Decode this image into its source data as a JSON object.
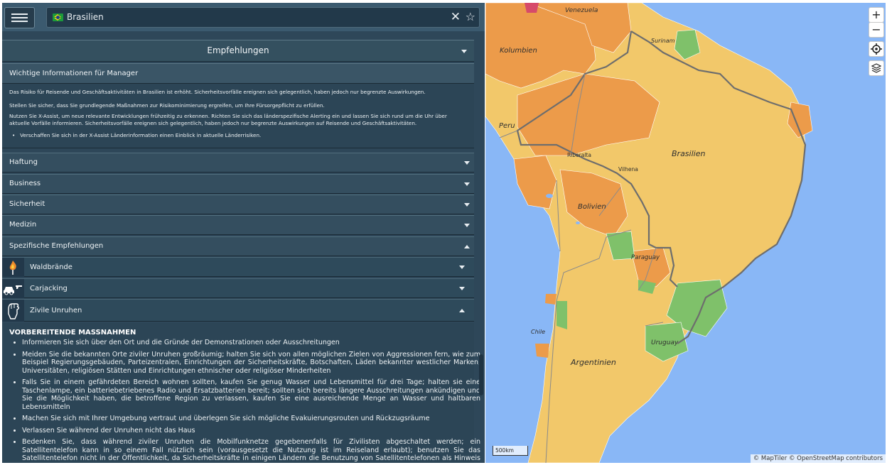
{
  "search": {
    "value": "Brasilien"
  },
  "recommendations": {
    "title": "Empfehlungen"
  },
  "manager_info": {
    "title": "Wichtige Informationen für Manager",
    "paragraphs": [
      "Das Risiko für Reisende und Geschäftsaktivitäten in Brasilien ist erhöht. Sicherheitsvorfälle ereignen sich gelegentlich, haben jedoch nur begrenzte Auswirkungen.",
      "Stellen Sie sicher, dass Sie grundlegende Maßnahmen zur Risikominimierung ergreifen, um Ihre Fürsorgepflicht zu erfüllen.",
      "Nutzen Sie X-Assist, um neue relevante Entwicklungen frühzeitig zu erkennen. Richten Sie sich das länderspezifische Alerting ein und lassen Sie sich rund um die Uhr über aktuelle Vorfälle informieren. Sicherheitsvorfälle ereignen sich gelegentlich, haben jedoch nur begrenzte Auswirkungen auf Reisende und Geschäftsaktivitäten."
    ],
    "bullet": "Verschaffen Sie sich in der X-Assist Länderinformation einen Einblick in aktuelle Länderrisiken."
  },
  "sections": [
    "Haftung",
    "Business",
    "Sicherheit",
    "Medizin",
    "Spezifische Empfehlungen"
  ],
  "specific": [
    {
      "label": "Waldbrände",
      "icon": "fire-icon"
    },
    {
      "label": "Carjacking",
      "icon": "car-gun-icon"
    },
    {
      "label": "Zivile Unruhen",
      "icon": "raised-fist-icon"
    }
  ],
  "preparation": {
    "heading": "VORBEREITENDE MASSNAHMEN",
    "items": [
      "Informieren Sie sich über den Ort und die Gründe der Demonstrationen oder Ausschreitungen",
      "Meiden Sie die bekannten Orte ziviler Unruhen großräumig; halten Sie sich von allen möglichen Zielen von Aggressionen fern, wie zum Beispiel Regierungsgebäuden, Parteizentralen, Einrichtungen der Sicherheitskräfte, Botschaften, Läden bekannter westlicher Marken, Universitäten, religiösen Stätten und Einrichtungen ethnischer oder religiöser Minderheiten",
      "Falls Sie in einem gefährdeten Bereich wohnen sollten, kaufen Sie genug Wasser und Lebensmittel für drei Tage; halten sie eine Taschenlampe, ein batteriebetriebenes Radio und Ersatzbatterien bereit; sollten sich bereits längere Ausschreitungen ankündigen und Sie die Möglichkeit haben, die betroffene Region zu verlassen, kaufen Sie eine ausreichende Menge an Wasser und haltbaren Lebensmitteln",
      "Machen Sie sich mit Ihrer Umgebung vertraut und überlegen Sie sich mögliche Evakuierungsrouten und Rückzugsräume",
      "Verlassen Sie während der Unruhen nicht das Haus",
      "Bedenken Sie, dass während ziviler Unruhen die Mobilfunknetze gegebenenfalls für Zivilisten abgeschaltet werden; ein Satellitentelefon kann in so einem Fall nützlich sein (vorausgesetzt die Nutzung ist im Reiseland erlaubt); benutzen Sie das Satellitentelefon nicht in der Öffentlichkeit, da Sicherheitskräfte in einigen Ländern die Benutzung von Satellitentelefonen als Hinweis auf Spionage ansehen;"
    ]
  },
  "map": {
    "zoom_in": "+",
    "zoom_out": "−",
    "scale": "500km",
    "attribution": "© MapTiler © OpenStreetMap contributors",
    "country_labels": [
      "Venezuela",
      "Kolumbien",
      "Surinam",
      "Peru",
      "Brasilien",
      "Bolivien",
      "Paraguay",
      "Chile",
      "Uruguay",
      "Argentinien"
    ],
    "city_labels": [
      "Riberalta",
      "Vilhena"
    ],
    "colors": {
      "ocean": "#89b7f6",
      "low": "#f2c86a",
      "medium": "#ec9b4a",
      "green": "#7fc16a",
      "high": "#d64a6a"
    }
  }
}
